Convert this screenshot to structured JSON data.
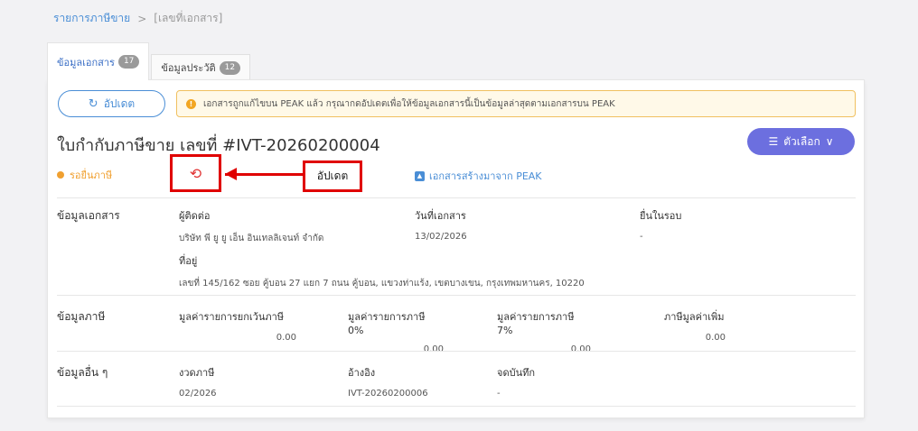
{
  "breadcrumb": {
    "parent": "รายการภาษีขาย",
    "separator": ">",
    "current": "[เลขที่เอกสาร]"
  },
  "tabs": [
    {
      "label": "ข้อมูลเอกสาร",
      "count": "17"
    },
    {
      "label": "ข้อมูลประวัติ",
      "count": "12"
    }
  ],
  "toolbar": {
    "refresh_label": "อัปเดต",
    "options_label": "ตัวเลือก"
  },
  "notice": {
    "text": "เอกสารถูกแก้ไขบน PEAK แล้ว กรุณากดอัปเดตเพื่อให้ข้อมูลเอกสารนี้เป็นข้อมูลล่าสุดตามเอกสารบน PEAK"
  },
  "document": {
    "title": "ใบกำกับภาษีขาย เลขที่ #IVT-20260200004",
    "status": "รอยื่นภาษี",
    "source_link": "เอกสารสร้างมาจาก PEAK"
  },
  "annotation": {
    "callout": "อัปเดต"
  },
  "sections": {
    "doc_info": {
      "label": "ข้อมูลเอกสาร",
      "contact_label": "ผู้ติดต่อ",
      "contact_value": "บริษัท พี ยู ยู เอ็น อินเทลลิเจนท์ จำกัด",
      "date_label": "วันที่เอกสาร",
      "date_value": "13/02/2026",
      "round_label": "ยื่นในรอบ",
      "round_value": "-",
      "address_label": "ที่อยู่",
      "address_value": "เลขที่ 145/162 ซอย คู้บอน 27 แยก 7 ถนน คู้บอน, แขวงท่าแร้ง, เขตบางเขน, กรุงเทพมหานคร, 10220"
    },
    "tax_info": {
      "label": "ข้อมูลภาษี",
      "exempt_label": "มูลค่ารายการยกเว้นภาษี",
      "exempt_value": "0.00",
      "zero_label": "มูลค่ารายการภาษี 0%",
      "zero_value": "0.00",
      "seven_label": "มูลค่ารายการภาษี 7%",
      "seven_value": "0.00",
      "vat_label": "ภาษีมูลค่าเพิ่ม",
      "vat_value": "0.00"
    },
    "other_info": {
      "label": "ข้อมูลอื่น ๆ",
      "period_label": "งวดภาษี",
      "period_value": "02/2026",
      "ref_label": "อ้างอิง",
      "ref_value": "IVT-20260200006",
      "note_label": "จดบันทึก",
      "note_value": "-"
    }
  },
  "colors": {
    "primary": "#4a8ed6",
    "options_bg": "#6c6fdf",
    "status": "#f0a030",
    "annotation": "#e00000"
  },
  "icons": {
    "refresh": "sync-icon",
    "warning": "warning-icon",
    "options": "menu-icon",
    "chevron": "chevron-down-icon",
    "peak": "peak-logo-icon"
  }
}
